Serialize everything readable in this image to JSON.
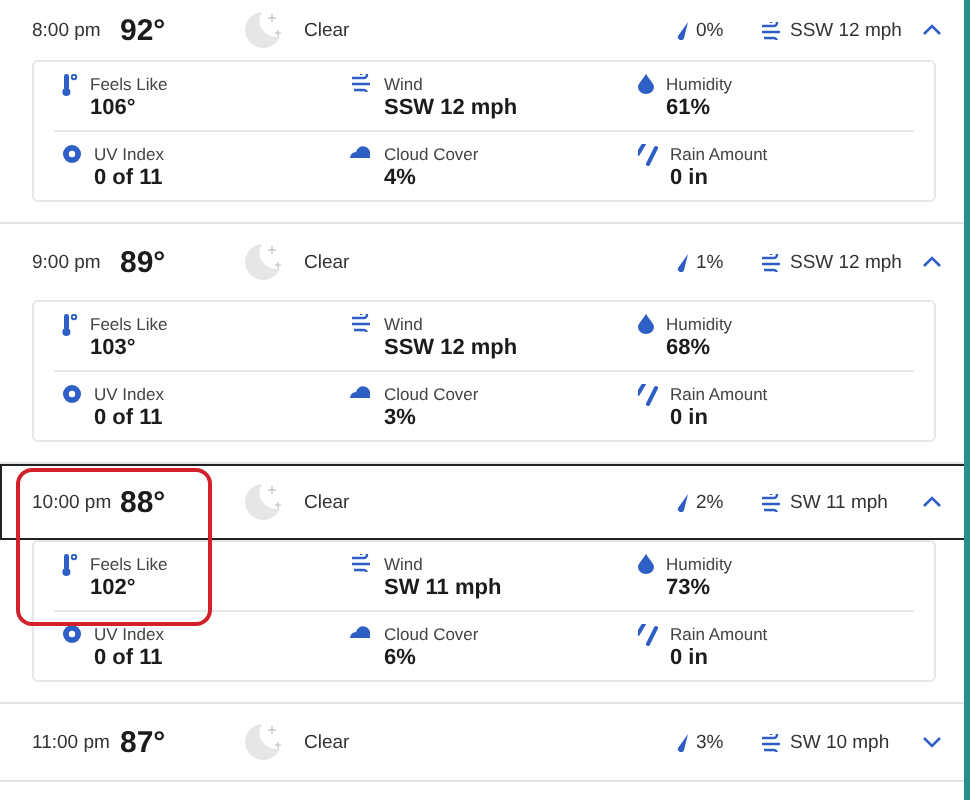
{
  "hours": [
    {
      "time": "8:00 pm",
      "temp": "92°",
      "condition": "Clear",
      "precip": "0%",
      "wind": "SSW 12 mph",
      "expanded": true,
      "selected": false,
      "highlighted": false,
      "details": [
        {
          "kind": "feels",
          "label": "Feels Like",
          "value": "106°"
        },
        {
          "kind": "wind",
          "label": "Wind",
          "value": "SSW 12 mph"
        },
        {
          "kind": "humidity",
          "label": "Humidity",
          "value": "61%"
        },
        {
          "kind": "uv",
          "label": "UV Index",
          "value": "0 of 11"
        },
        {
          "kind": "cloud",
          "label": "Cloud Cover",
          "value": "4%"
        },
        {
          "kind": "rain",
          "label": "Rain Amount",
          "value": "0 in"
        }
      ]
    },
    {
      "time": "9:00 pm",
      "temp": "89°",
      "condition": "Clear",
      "precip": "1%",
      "wind": "SSW 12 mph",
      "expanded": true,
      "selected": false,
      "highlighted": false,
      "details": [
        {
          "kind": "feels",
          "label": "Feels Like",
          "value": "103°"
        },
        {
          "kind": "wind",
          "label": "Wind",
          "value": "SSW 12 mph"
        },
        {
          "kind": "humidity",
          "label": "Humidity",
          "value": "68%"
        },
        {
          "kind": "uv",
          "label": "UV Index",
          "value": "0 of 11"
        },
        {
          "kind": "cloud",
          "label": "Cloud Cover",
          "value": "3%"
        },
        {
          "kind": "rain",
          "label": "Rain Amount",
          "value": "0 in"
        }
      ]
    },
    {
      "time": "10:00 pm",
      "temp": "88°",
      "condition": "Clear",
      "precip": "2%",
      "wind": "SW 11 mph",
      "expanded": true,
      "selected": true,
      "highlighted": true,
      "details": [
        {
          "kind": "feels",
          "label": "Feels Like",
          "value": "102°"
        },
        {
          "kind": "wind",
          "label": "Wind",
          "value": "SW 11 mph"
        },
        {
          "kind": "humidity",
          "label": "Humidity",
          "value": "73%"
        },
        {
          "kind": "uv",
          "label": "UV Index",
          "value": "0 of 11"
        },
        {
          "kind": "cloud",
          "label": "Cloud Cover",
          "value": "6%"
        },
        {
          "kind": "rain",
          "label": "Rain Amount",
          "value": "0 in"
        }
      ]
    },
    {
      "time": "11:00 pm",
      "temp": "87°",
      "condition": "Clear",
      "precip": "3%",
      "wind": "SW 10 mph",
      "expanded": false,
      "selected": false,
      "highlighted": false
    }
  ]
}
